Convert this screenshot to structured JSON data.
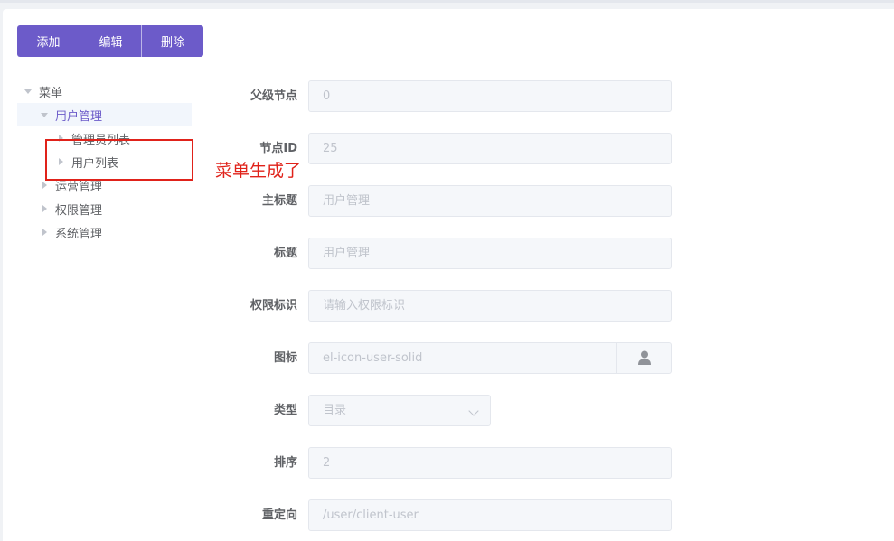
{
  "toolbar": {
    "add_label": "添加",
    "edit_label": "编辑",
    "delete_label": "删除"
  },
  "tree": {
    "root": "菜单",
    "items": [
      {
        "label": "用户管理",
        "expanded": true,
        "active": true,
        "children": [
          {
            "label": "管理员列表"
          },
          {
            "label": "用户列表"
          }
        ]
      },
      {
        "label": "运营管理"
      },
      {
        "label": "权限管理"
      },
      {
        "label": "系统管理"
      }
    ]
  },
  "annotation": {
    "text": "菜单生成了",
    "color": "#e0221a"
  },
  "form": {
    "parent_node": {
      "label": "父级节点",
      "value": "0"
    },
    "node_id": {
      "label": "节点ID",
      "value": "25"
    },
    "main_title": {
      "label": "主标题",
      "value": "用户管理"
    },
    "title": {
      "label": "标题",
      "value": "用户管理"
    },
    "permission": {
      "label": "权限标识",
      "placeholder": "请输入权限标识"
    },
    "icon": {
      "label": "图标",
      "value": "el-icon-user-solid",
      "icon_name": "user-solid-icon"
    },
    "type": {
      "label": "类型",
      "value": "目录"
    },
    "sort": {
      "label": "排序",
      "value": "2"
    },
    "redirect": {
      "label": "重定向",
      "value": "/user/client-user"
    }
  },
  "colors": {
    "primary": "#6c5bc9",
    "active_bg": "#f2f6fc",
    "field_bg": "#f5f7fa"
  }
}
